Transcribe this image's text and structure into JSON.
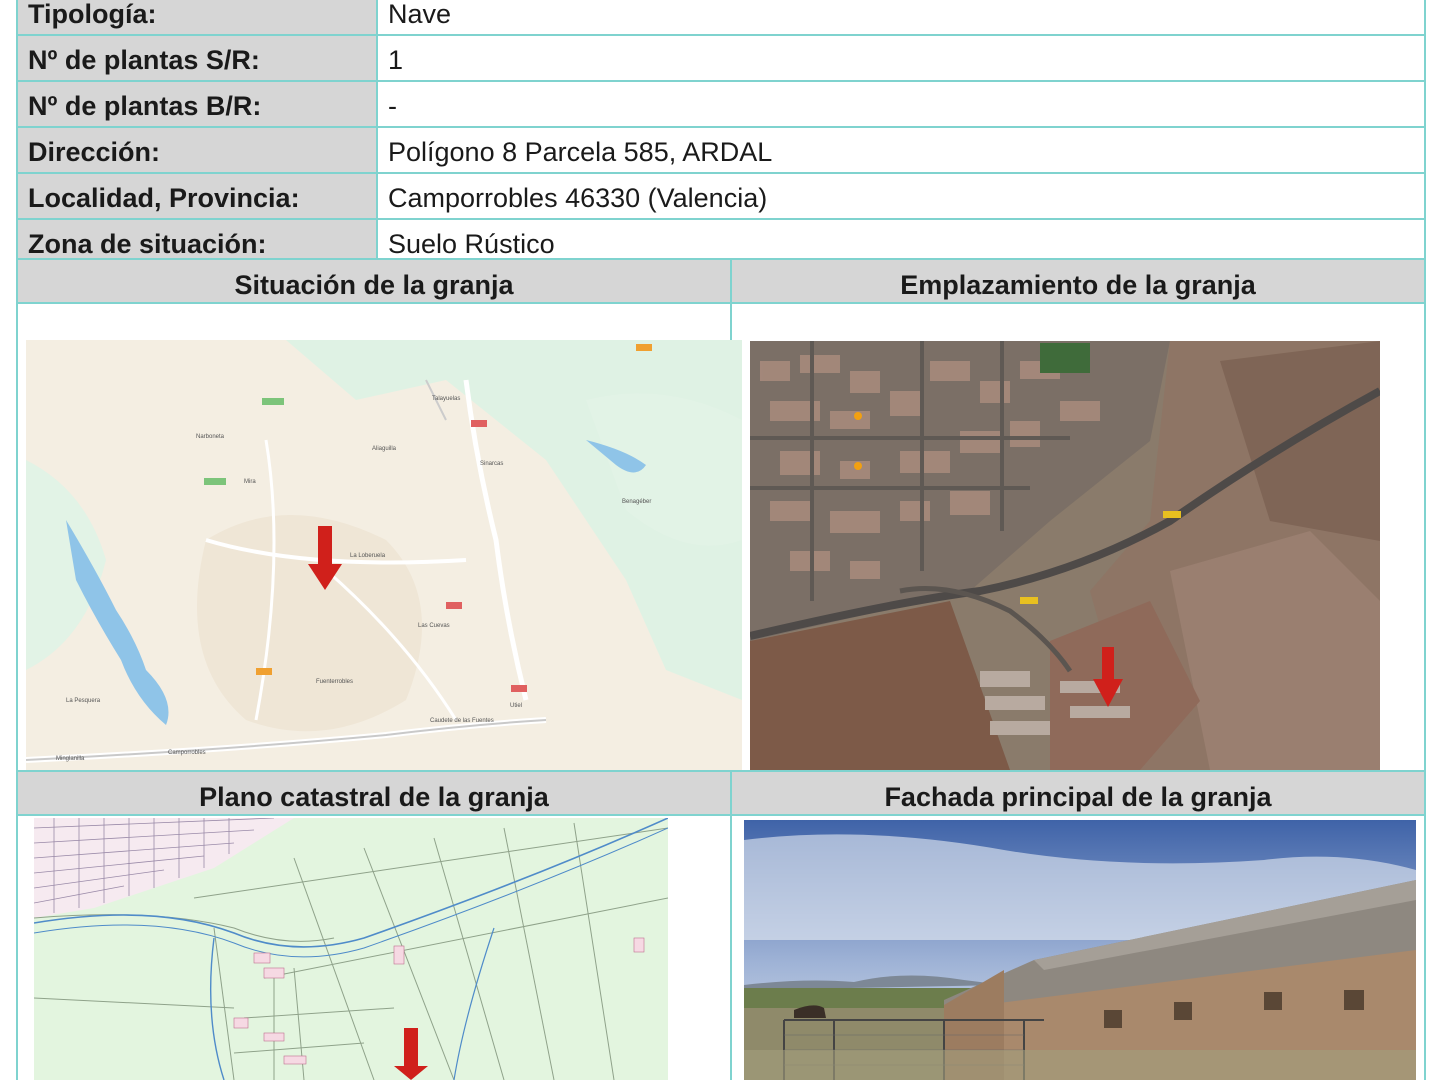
{
  "info": {
    "rows": [
      {
        "label": "Tipología:",
        "value": "Nave"
      },
      {
        "label": "Nº de plantas S/R:",
        "value": "1"
      },
      {
        "label": "Nº de plantas B/R:",
        "value": "-"
      },
      {
        "label": "Dirección:",
        "value": "Polígono 8 Parcela 585, ARDAL"
      },
      {
        "label": "Localidad, Provincia:",
        "value": "Camporrobles 46330 (Valencia)"
      },
      {
        "label": "Zona de situación:",
        "value": "Suelo Rústico"
      }
    ]
  },
  "sections": {
    "situacion": "Situación de la granja",
    "emplazamiento": "Emplazamiento de la granja",
    "catastral": "Plano catastral de la granja",
    "fachada": "Fachada principal de la granja"
  },
  "map_labels": {
    "narboneta": "Narboneta",
    "mira": "Mira",
    "camporrobles": "Camporrobles",
    "utiel": "Utiel",
    "aliaguilla": "Aliaguilla",
    "sinarcas": "Sinarcas",
    "la_pesquera": "La Pesquera",
    "fuenterrobles": "Fuenterrobles",
    "talayuelas": "Talayuelas",
    "la_lobera": "La Loberuela",
    "los_cuevas": "Las Cuevas",
    "caudete": "Caudete de las Fuentes",
    "benagéber": "Benagéber",
    "minglanilla": "Minglanilla"
  },
  "colors": {
    "border": "#7fd3cf",
    "header_bg": "#d6d6d6",
    "arrow": "#d0201b"
  }
}
